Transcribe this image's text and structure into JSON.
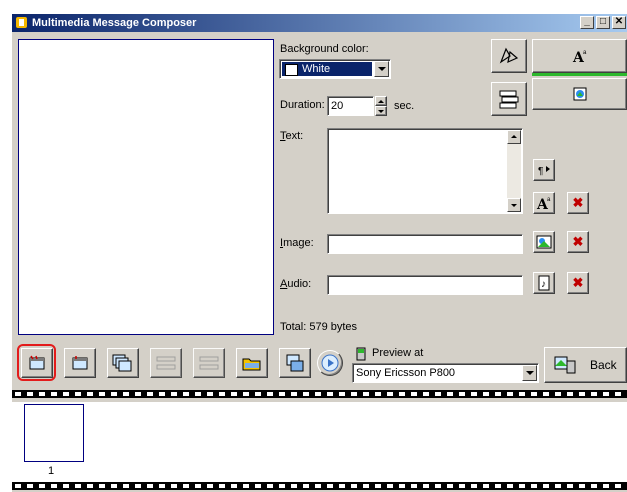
{
  "window": {
    "title": "Multimedia Message Composer"
  },
  "background": {
    "label": "Background color:",
    "value": "White",
    "swatch_color": "#ffffff"
  },
  "duration": {
    "label": "Duration:",
    "value": "20",
    "unit": "sec."
  },
  "text_field": {
    "label": "Text:",
    "value": ""
  },
  "image_field": {
    "label": "Image:",
    "value": ""
  },
  "audio_field": {
    "label": "Audio:",
    "value": ""
  },
  "total": "Total: 579 bytes",
  "preview": {
    "label": "Preview at",
    "device": "Sony Ericsson P800"
  },
  "back_button": {
    "label": "Back"
  },
  "slides": [
    {
      "number": "1"
    }
  ],
  "colors": {
    "accent_bar": "#2db82d",
    "selection_highlight": "#e31b1b",
    "title_start": "#0a246a",
    "title_end": "#a6caf0"
  },
  "icons": [
    "app-icon",
    "rotate-icon",
    "text-style-icon",
    "image-style-icon",
    "text-direction-icon",
    "font-icon",
    "delete-icon",
    "image-browse-icon",
    "audio-browse-icon",
    "new-slide-icon",
    "insert-slide-icon",
    "copy-slide-icon",
    "open-folder-icon",
    "save-icon",
    "play-icon",
    "phone-icon",
    "back-icon"
  ]
}
